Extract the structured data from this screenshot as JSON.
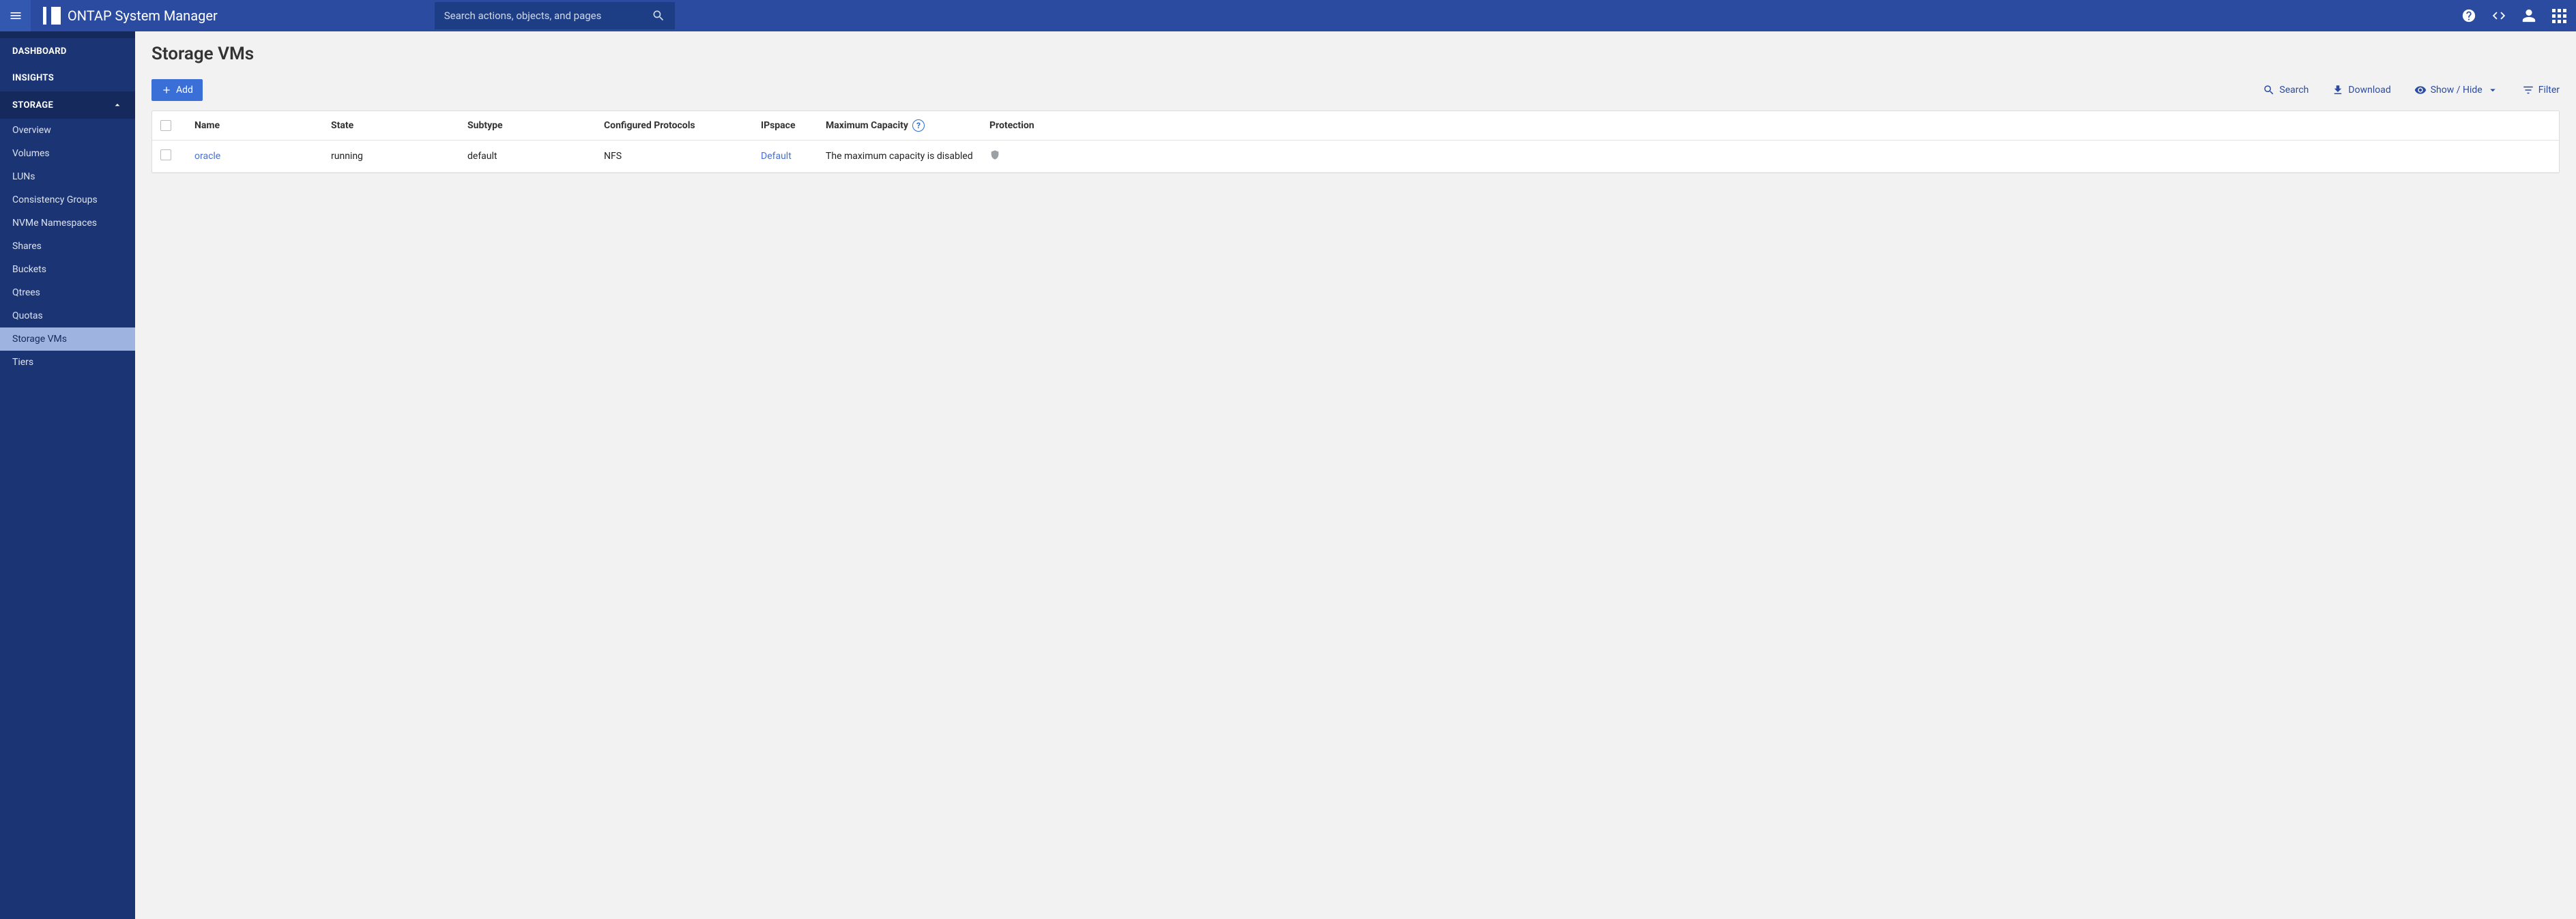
{
  "header": {
    "app_title": "ONTAP System Manager",
    "search_placeholder": "Search actions, objects, and pages"
  },
  "sidebar": {
    "dashboard": "DASHBOARD",
    "insights": "INSIGHTS",
    "storage": "STORAGE",
    "items": [
      "Overview",
      "Volumes",
      "LUNs",
      "Consistency Groups",
      "NVMe Namespaces",
      "Shares",
      "Buckets",
      "Qtrees",
      "Quotas",
      "Storage VMs",
      "Tiers"
    ]
  },
  "page": {
    "title": "Storage VMs",
    "add_label": "Add",
    "actions": {
      "search": "Search",
      "download": "Download",
      "showhide": "Show / Hide",
      "filter": "Filter"
    }
  },
  "table": {
    "columns": {
      "name": "Name",
      "state": "State",
      "subtype": "Subtype",
      "protocols": "Configured Protocols",
      "ipspace": "IPspace",
      "maxcap": "Maximum Capacity",
      "protection": "Protection"
    },
    "rows": [
      {
        "name": "oracle",
        "state": "running",
        "subtype": "default",
        "protocols": "NFS",
        "ipspace": "Default",
        "maxcap": "The maximum capacity is disabled"
      }
    ]
  }
}
